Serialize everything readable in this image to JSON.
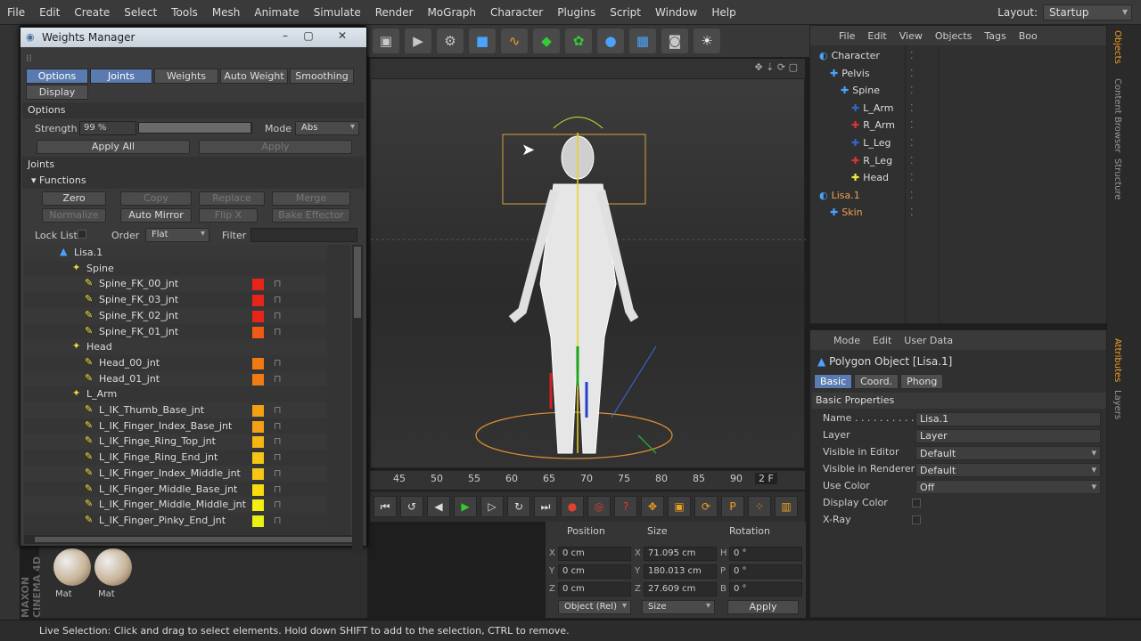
{
  "menubar": {
    "items": [
      "File",
      "Edit",
      "Create",
      "Select",
      "Tools",
      "Mesh",
      "Animate",
      "Simulate",
      "Render",
      "MoGraph",
      "Character",
      "Plugins",
      "Script",
      "Window",
      "Help"
    ],
    "layout_label": "Layout:",
    "layout_value": "Startup"
  },
  "toolbar_icons": [
    "rig-icon",
    "camera-group-icon",
    "cube-icon",
    "spline-icon",
    "generator-icon",
    "deformer-icon",
    "environment-icon",
    "floor-icon",
    "camera-icon",
    "light-icon"
  ],
  "weights_manager": {
    "title": "Weights Manager",
    "tabs": [
      "Options",
      "Joints",
      "Weights",
      "Auto Weight",
      "Smoothing",
      "Display"
    ],
    "options_header": "Options",
    "strength_label": "Strength",
    "strength_value": "99 %",
    "strength_fraction": 0.99,
    "mode_label": "Mode",
    "mode_value": "Abs",
    "apply_all": "Apply All",
    "apply": "Apply",
    "joints_header": "Joints",
    "functions_header": "Functions",
    "buttons": {
      "zero": "Zero",
      "copy": "Copy",
      "replace": "Replace",
      "merge": "Merge",
      "normalize": "Normalize",
      "auto_mirror": "Auto Mirror",
      "flip": "Flip X",
      "bake": "Bake Effector"
    },
    "lock_list": "Lock List",
    "order_label": "Order",
    "order_value": "Flat",
    "filter_label": "Filter",
    "tree": [
      {
        "name": "Lisa.1",
        "level": 0
      },
      {
        "name": "Spine",
        "level": 1
      },
      {
        "name": "Spine_FK_00_jnt",
        "level": 2,
        "color": "#e8241a"
      },
      {
        "name": "Spine_FK_03_jnt",
        "level": 2,
        "color": "#e8241a"
      },
      {
        "name": "Spine_FK_02_jnt",
        "level": 2,
        "color": "#e8241a"
      },
      {
        "name": "Spine_FK_01_jnt",
        "level": 2,
        "color": "#ef5a14"
      },
      {
        "name": "Head",
        "level": 1
      },
      {
        "name": "Head_00_jnt",
        "level": 2,
        "color": "#f07a14"
      },
      {
        "name": "Head_01_jnt",
        "level": 2,
        "color": "#f07a14"
      },
      {
        "name": "L_Arm",
        "level": 1
      },
      {
        "name": "L_IK_Thumb_Base_jnt",
        "level": 2,
        "color": "#f4a014"
      },
      {
        "name": "L_IK_Finger_Index_Base_jnt",
        "level": 2,
        "color": "#f4a014"
      },
      {
        "name": "L_IK_Finge_Ring_Top_jnt",
        "level": 2,
        "color": "#f6b612"
      },
      {
        "name": "L_IK_Finge_Ring_End_jnt",
        "level": 2,
        "color": "#f6c612"
      },
      {
        "name": "L_IK_Finger_Index_Middle_jnt",
        "level": 2,
        "color": "#f6c612"
      },
      {
        "name": "L_IK_Finger_Middle_Base_jnt",
        "level": 2,
        "color": "#f8dc10"
      },
      {
        "name": "L_IK_Finger_Middle_Middle_jnt",
        "level": 2,
        "color": "#f4ee12"
      },
      {
        "name": "L_IK_Finger_Pinky_End_jnt",
        "level": 2,
        "color": "#e8f014"
      }
    ]
  },
  "timeline": {
    "ticks": [
      "45",
      "50",
      "55",
      "60",
      "65",
      "70",
      "75",
      "80",
      "85",
      "90"
    ],
    "frame": "2 F"
  },
  "coords": {
    "position_label": "Position",
    "size_label": "Size",
    "rotation_label": "Rotation",
    "pos": [
      "0 cm",
      "0 cm",
      "0 cm"
    ],
    "size": [
      "71.095 cm",
      "180.013 cm",
      "27.609 cm"
    ],
    "rot": [
      "0 °",
      "0 °",
      "0 °"
    ],
    "axis_pos": [
      "X",
      "Y",
      "Z"
    ],
    "axis_rot": [
      "H",
      "P",
      "B"
    ],
    "object_mode": "Object (Rel)",
    "size_mode": "Size",
    "apply": "Apply"
  },
  "materials": [
    "Mat",
    "Mat"
  ],
  "objects": {
    "menu": [
      "File",
      "Edit",
      "View",
      "Objects",
      "Tags",
      "Boo"
    ],
    "tree": [
      {
        "name": "Character",
        "indent": 0,
        "color": "#ddd"
      },
      {
        "name": "Pelvis",
        "indent": 1,
        "color": "#ddd"
      },
      {
        "name": "Spine",
        "indent": 2,
        "color": "#ddd"
      },
      {
        "name": "L_Arm",
        "indent": 3,
        "color": "#ddd"
      },
      {
        "name": "R_Arm",
        "indent": 3,
        "color": "#ddd"
      },
      {
        "name": "L_Leg",
        "indent": 3,
        "color": "#ddd"
      },
      {
        "name": "R_Leg",
        "indent": 3,
        "color": "#ddd"
      },
      {
        "name": "Head",
        "indent": 3,
        "color": "#ddd"
      },
      {
        "name": "Lisa.1",
        "indent": 0,
        "color": "#f0a050"
      },
      {
        "name": "Skin",
        "indent": 1,
        "color": "#f0a050"
      }
    ]
  },
  "attributes": {
    "menu": [
      "Mode",
      "Edit",
      "User Data"
    ],
    "object_title": "Polygon Object [Lisa.1]",
    "tabs": [
      "Basic",
      "Coord.",
      "Phong"
    ],
    "section": "Basic Properties",
    "rows": [
      {
        "label": "Name . . . . . . . . . .",
        "value": "Lisa.1"
      },
      {
        "label": "Layer",
        "value": "Layer"
      },
      {
        "label": "Visible in Editor",
        "value": "Default"
      },
      {
        "label": "Visible in Renderer",
        "value": "Default"
      },
      {
        "label": "Use Color",
        "value": "Off"
      },
      {
        "label": "Display Color",
        "value": ""
      },
      {
        "label": "X-Ray",
        "value": ""
      }
    ]
  },
  "side_tabs": [
    "Objects",
    "Content Browser",
    "Structure",
    "Attributes",
    "Layers"
  ],
  "brand": "MAXON CINEMA 4D",
  "status": "Live Selection: Click and drag to select elements. Hold down SHIFT to add to the selection, CTRL to remove."
}
